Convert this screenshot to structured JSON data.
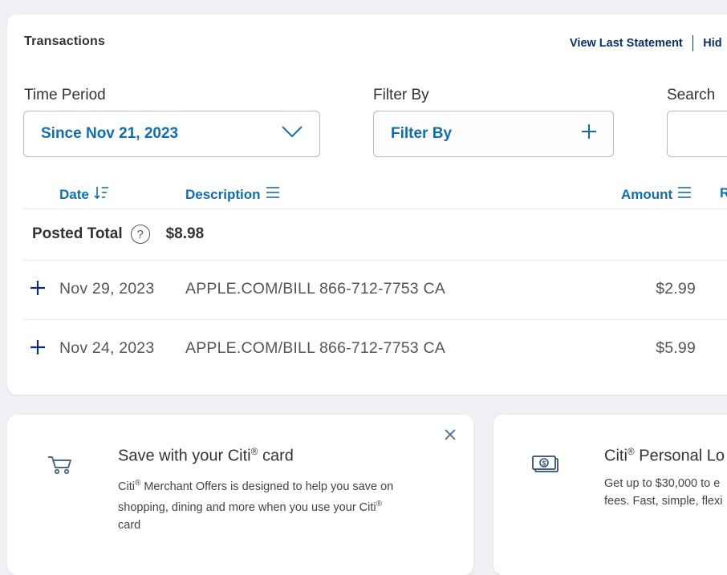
{
  "transactions": {
    "title": "Transactions",
    "view_last_statement": "View Last Statement",
    "hide_link": "Hid",
    "time_period": {
      "label": "Time Period",
      "value": "Since Nov 21, 2023"
    },
    "filter": {
      "label": "Filter By",
      "value": "Filter By"
    },
    "search": {
      "label": "Search",
      "value": ""
    },
    "columns": {
      "date": "Date",
      "description": "Description",
      "amount": "Amount",
      "extra": "R"
    },
    "posted_total": {
      "label": "Posted Total",
      "help": "?",
      "value": "$8.98"
    },
    "rows": [
      {
        "date": "Nov 29, 2023",
        "description": "APPLE.COM/BILL 866-712-7753 CA",
        "amount": "$2.99"
      },
      {
        "date": "Nov 24, 2023",
        "description": "APPLE.COM/BILL 866-712-7753 CA",
        "amount": "$5.99"
      }
    ]
  },
  "offers": {
    "merchant": {
      "title_pre": "Save with your Citi",
      "title_sup": "®",
      "title_post": " card",
      "body_l1_pre": "Citi",
      "body_l1_sup": "®",
      "body_l1_post": " Merchant Offers is designed to help you save on",
      "body_l2_pre": "shopping, dining and more when you use your Citi",
      "body_l2_sup": "®",
      "body_l3": "card"
    },
    "loan": {
      "title_pre": "Citi",
      "title_sup": "®",
      "title_post": " Personal Lo",
      "body_l1": "Get up to $30,000 to e",
      "body_l2": "fees. Fast, simple, flexi"
    }
  },
  "icons": {
    "cart": "cart-icon",
    "money": "money-icon",
    "close": "close-icon",
    "chevron": "chevron-down-icon",
    "plus": "plus-icon",
    "sort": "sort-icon",
    "menu": "menu-lines-icon"
  },
  "colors": {
    "link_blue": "#0f6eb3",
    "navy": "#0a2f6b",
    "text": "#333333",
    "background": "#eef0f4"
  }
}
